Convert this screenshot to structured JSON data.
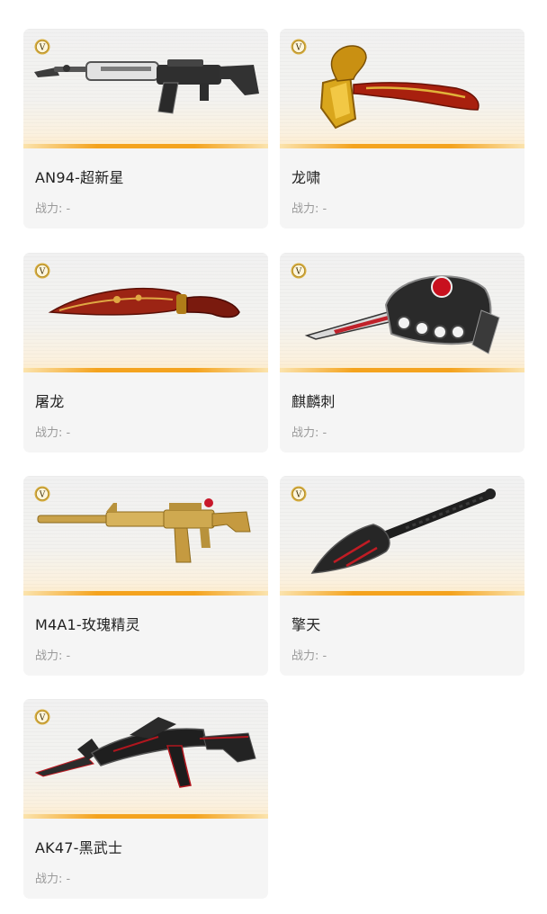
{
  "power_label": "战力:",
  "power_value": "-",
  "badge_letter": "V",
  "items": [
    {
      "name": "AN94-超新星",
      "icon": "an94-rifle-icon"
    },
    {
      "name": "龙啸",
      "icon": "dragon-axe-icon"
    },
    {
      "name": "屠龙",
      "icon": "kukri-knife-icon"
    },
    {
      "name": "麒麟刺",
      "icon": "knuckle-blade-icon"
    },
    {
      "name": "M4A1-玫瑰精灵",
      "icon": "m4a1-rifle-icon"
    },
    {
      "name": "擎天",
      "icon": "shovel-icon"
    },
    {
      "name": "AK47-黑武士",
      "icon": "ak47-rifle-icon"
    }
  ],
  "colors": {
    "accent_bar": "#f4a31e",
    "badge_gold": "#d6ad3e",
    "card_bg": "#f5f5f5"
  }
}
